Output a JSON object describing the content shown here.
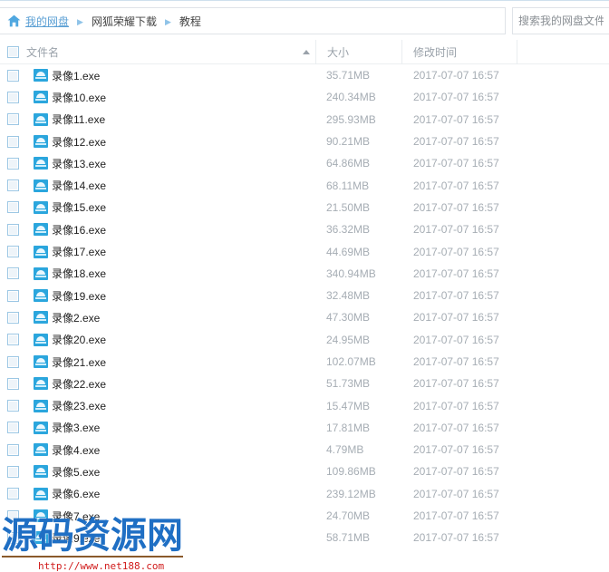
{
  "breadcrumb": {
    "home_icon": "home-icon",
    "separator": "▶",
    "items": [
      {
        "label": "我的网盘",
        "type": "link"
      },
      {
        "label": "网狐荣耀下载",
        "type": "text"
      },
      {
        "label": "教程",
        "type": "text"
      }
    ]
  },
  "search": {
    "placeholder": "搜索我的网盘文件",
    "value": ""
  },
  "table": {
    "columns": {
      "name": "文件名",
      "size": "大小",
      "time": "修改时间",
      "extra": ""
    },
    "sort_column": "name",
    "sort_direction": "asc",
    "sort_arrow_glyph": "▲",
    "rows": [
      {
        "name": "录像1.exe",
        "size": "35.71MB",
        "time": "2017-07-07 16:57",
        "icon": "exe-file-icon",
        "checked": false
      },
      {
        "name": "录像10.exe",
        "size": "240.34MB",
        "time": "2017-07-07 16:57",
        "icon": "exe-file-icon",
        "checked": false
      },
      {
        "name": "录像11.exe",
        "size": "295.93MB",
        "time": "2017-07-07 16:57",
        "icon": "exe-file-icon",
        "checked": false
      },
      {
        "name": "录像12.exe",
        "size": "90.21MB",
        "time": "2017-07-07 16:57",
        "icon": "exe-file-icon",
        "checked": false
      },
      {
        "name": "录像13.exe",
        "size": "64.86MB",
        "time": "2017-07-07 16:57",
        "icon": "exe-file-icon",
        "checked": false
      },
      {
        "name": "录像14.exe",
        "size": "68.11MB",
        "time": "2017-07-07 16:57",
        "icon": "exe-file-icon",
        "checked": false
      },
      {
        "name": "录像15.exe",
        "size": "21.50MB",
        "time": "2017-07-07 16:57",
        "icon": "exe-file-icon",
        "checked": false
      },
      {
        "name": "录像16.exe",
        "size": "36.32MB",
        "time": "2017-07-07 16:57",
        "icon": "exe-file-icon",
        "checked": false
      },
      {
        "name": "录像17.exe",
        "size": "44.69MB",
        "time": "2017-07-07 16:57",
        "icon": "exe-file-icon",
        "checked": false
      },
      {
        "name": "录像18.exe",
        "size": "340.94MB",
        "time": "2017-07-07 16:57",
        "icon": "exe-file-icon",
        "checked": false
      },
      {
        "name": "录像19.exe",
        "size": "32.48MB",
        "time": "2017-07-07 16:57",
        "icon": "exe-file-icon",
        "checked": false
      },
      {
        "name": "录像2.exe",
        "size": "47.30MB",
        "time": "2017-07-07 16:57",
        "icon": "exe-file-icon",
        "checked": false
      },
      {
        "name": "录像20.exe",
        "size": "24.95MB",
        "time": "2017-07-07 16:57",
        "icon": "exe-file-icon",
        "checked": false
      },
      {
        "name": "录像21.exe",
        "size": "102.07MB",
        "time": "2017-07-07 16:57",
        "icon": "exe-file-icon",
        "checked": false
      },
      {
        "name": "录像22.exe",
        "size": "51.73MB",
        "time": "2017-07-07 16:57",
        "icon": "exe-file-icon",
        "checked": false
      },
      {
        "name": "录像23.exe",
        "size": "15.47MB",
        "time": "2017-07-07 16:57",
        "icon": "exe-file-icon",
        "checked": false
      },
      {
        "name": "录像3.exe",
        "size": "17.81MB",
        "time": "2017-07-07 16:57",
        "icon": "exe-file-icon",
        "checked": false
      },
      {
        "name": "录像4.exe",
        "size": "4.79MB",
        "time": "2017-07-07 16:57",
        "icon": "exe-file-icon",
        "checked": false
      },
      {
        "name": "录像5.exe",
        "size": "109.86MB",
        "time": "2017-07-07 16:57",
        "icon": "exe-file-icon",
        "checked": false
      },
      {
        "name": "录像6.exe",
        "size": "239.12MB",
        "time": "2017-07-07 16:57",
        "icon": "exe-file-icon",
        "checked": false
      },
      {
        "name": "录像7.exe",
        "size": "24.70MB",
        "time": "2017-07-07 16:57",
        "icon": "exe-file-icon",
        "checked": false
      },
      {
        "name": "录像9.exe",
        "size": "58.71MB",
        "time": "2017-07-07 16:57",
        "icon": "exe-file-icon",
        "checked": false
      }
    ]
  },
  "watermark": {
    "text": "源码资源网",
    "url": "http://www.net188.com",
    "text_color": "#1f6fc4",
    "url_color": "#d01a1a",
    "rule_color": "#8a5a2b"
  },
  "colors": {
    "accent": "#2ba6dd",
    "link": "#5a9fd4",
    "muted_text": "#a6adb4",
    "header_text": "#9aa2aa",
    "border": "#dfe3e8"
  }
}
